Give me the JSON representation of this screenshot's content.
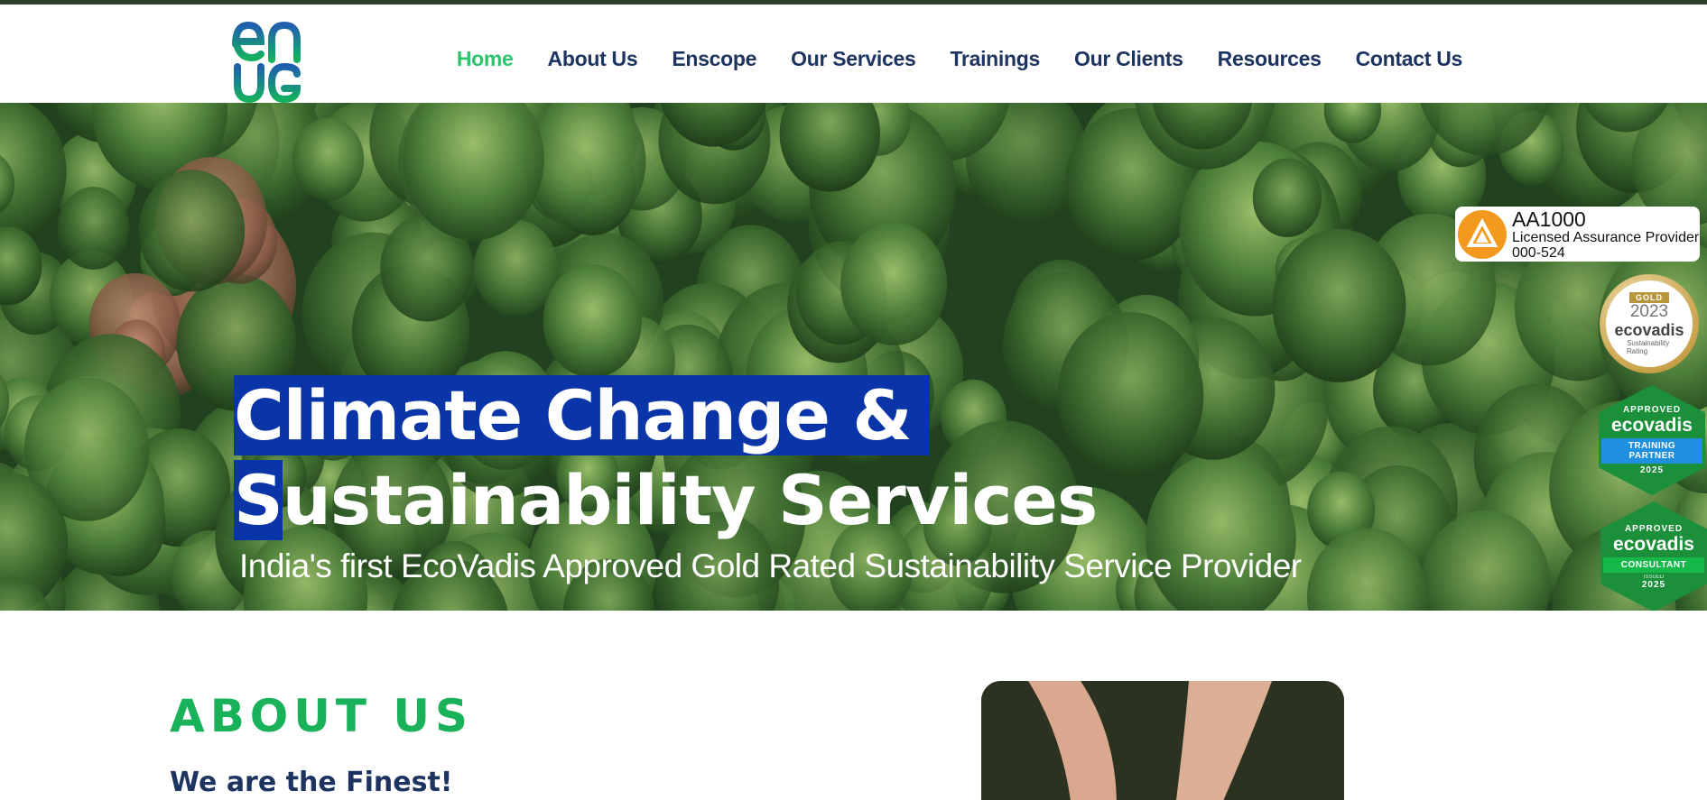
{
  "header": {
    "logo_alt": "enug",
    "nav": [
      {
        "label": "Home",
        "active": true
      },
      {
        "label": "About Us",
        "active": false
      },
      {
        "label": "Enscope",
        "active": false
      },
      {
        "label": "Our Services",
        "active": false
      },
      {
        "label": "Trainings",
        "active": false
      },
      {
        "label": "Our Clients",
        "active": false
      },
      {
        "label": "Resources",
        "active": false
      },
      {
        "label": "Contact Us",
        "active": false
      }
    ]
  },
  "hero": {
    "title_line1": "Climate Change &",
    "title_line2": "Sustainability Services",
    "subtitle": "India's first EcoVadis Approved Gold Rated Sustainability Service Provider"
  },
  "badges": {
    "aa1000": {
      "title": "AA1000",
      "line2": "Licensed Assurance Provider",
      "line3": "000-524"
    },
    "gold": {
      "tier": "GOLD",
      "year": "2023",
      "brand": "ecovadis",
      "caption": "Sustainability Rating"
    },
    "training": {
      "approved": "APPROVED",
      "brand": "ecovadis",
      "role": "TRAINING PARTNER",
      "year": "2025"
    },
    "consultant": {
      "approved": "APPROVED",
      "brand": "ecovadis",
      "role": "CONSULTANT",
      "issued": "ISSUED",
      "year": "2025"
    }
  },
  "about": {
    "title": "ABOUT US",
    "subtitle": "We are the Finest!"
  },
  "colors": {
    "nav_text": "#1d3461",
    "nav_active": "#2cc56d",
    "highlight": "#0a35a8",
    "about_title": "#19b159"
  }
}
